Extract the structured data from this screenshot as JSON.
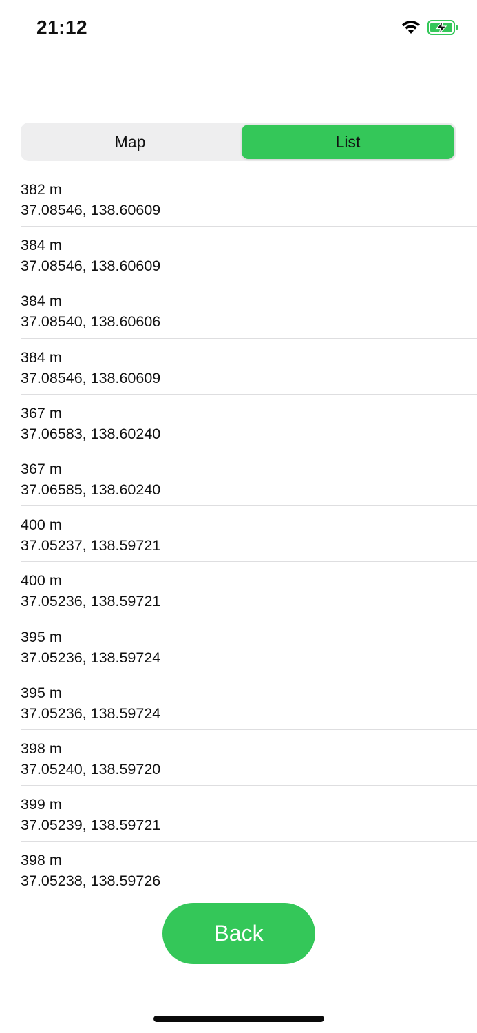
{
  "status_bar": {
    "time": "21:12",
    "icons": [
      "wifi-icon",
      "battery-charging-icon"
    ],
    "battery_color": "#34c759"
  },
  "segmented_control": {
    "options": [
      {
        "label": "Map",
        "selected": false
      },
      {
        "label": "List",
        "selected": true
      }
    ],
    "accent_color": "#34c759"
  },
  "list": {
    "items": [
      {
        "altitude": "382 m",
        "coords": "37.08546, 138.60609"
      },
      {
        "altitude": "384 m",
        "coords": "37.08546, 138.60609"
      },
      {
        "altitude": "384 m",
        "coords": "37.08540, 138.60606"
      },
      {
        "altitude": "384 m",
        "coords": "37.08546, 138.60609"
      },
      {
        "altitude": "367 m",
        "coords": "37.06583, 138.60240"
      },
      {
        "altitude": "367 m",
        "coords": "37.06585, 138.60240"
      },
      {
        "altitude": "400 m",
        "coords": "37.05237, 138.59721"
      },
      {
        "altitude": "400 m",
        "coords": "37.05236, 138.59721"
      },
      {
        "altitude": "395 m",
        "coords": "37.05236, 138.59724"
      },
      {
        "altitude": "395 m",
        "coords": "37.05236, 138.59724"
      },
      {
        "altitude": "398 m",
        "coords": "37.05240, 138.59720"
      },
      {
        "altitude": "399 m",
        "coords": "37.05239, 138.59721"
      },
      {
        "altitude": "398 m",
        "coords": "37.05238, 138.59726"
      }
    ]
  },
  "back_button": {
    "label": "Back",
    "color": "#34c759"
  }
}
